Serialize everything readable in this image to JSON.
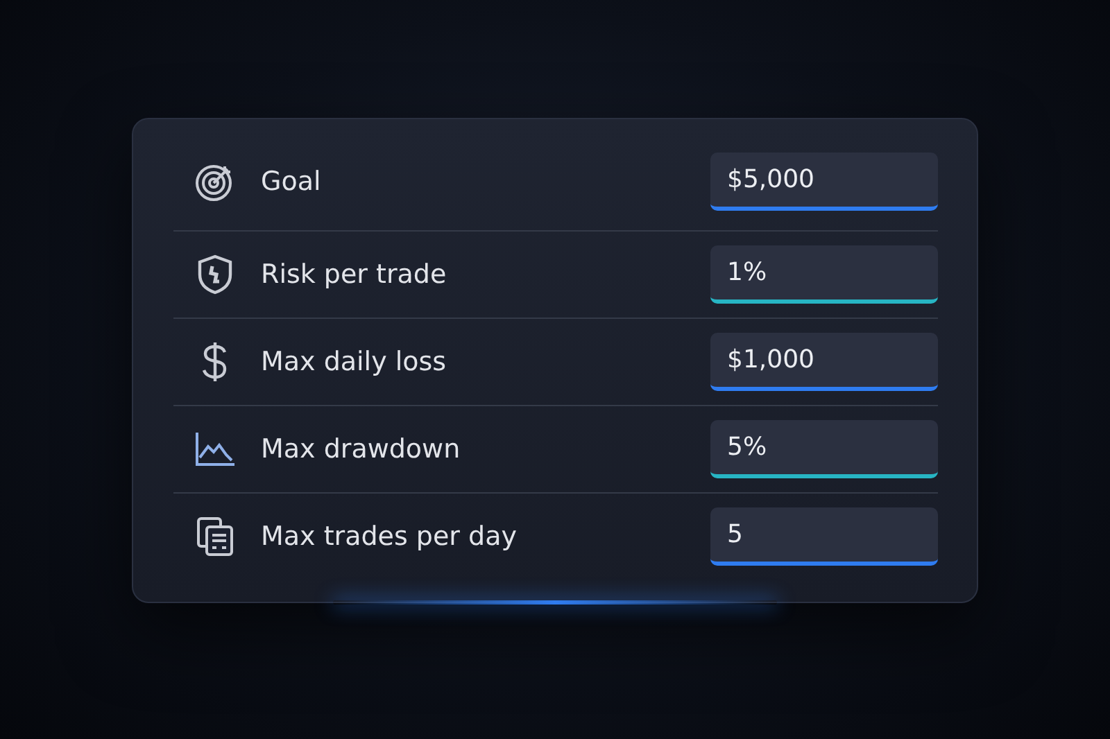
{
  "settings": [
    {
      "label": "Goal",
      "value": "$5,000",
      "color": "#2f7cf0"
    },
    {
      "label": "Risk per trade",
      "value": "1%",
      "color": "#27b5c4"
    },
    {
      "label": "Max daily loss",
      "value": "$1,000",
      "color": "#2f7cf0"
    },
    {
      "label": "Max drawdown",
      "value": "5%",
      "color": "#27b5c4"
    },
    {
      "label": "Max trades per day",
      "value": "5",
      "color": "#2f7cf0"
    }
  ]
}
